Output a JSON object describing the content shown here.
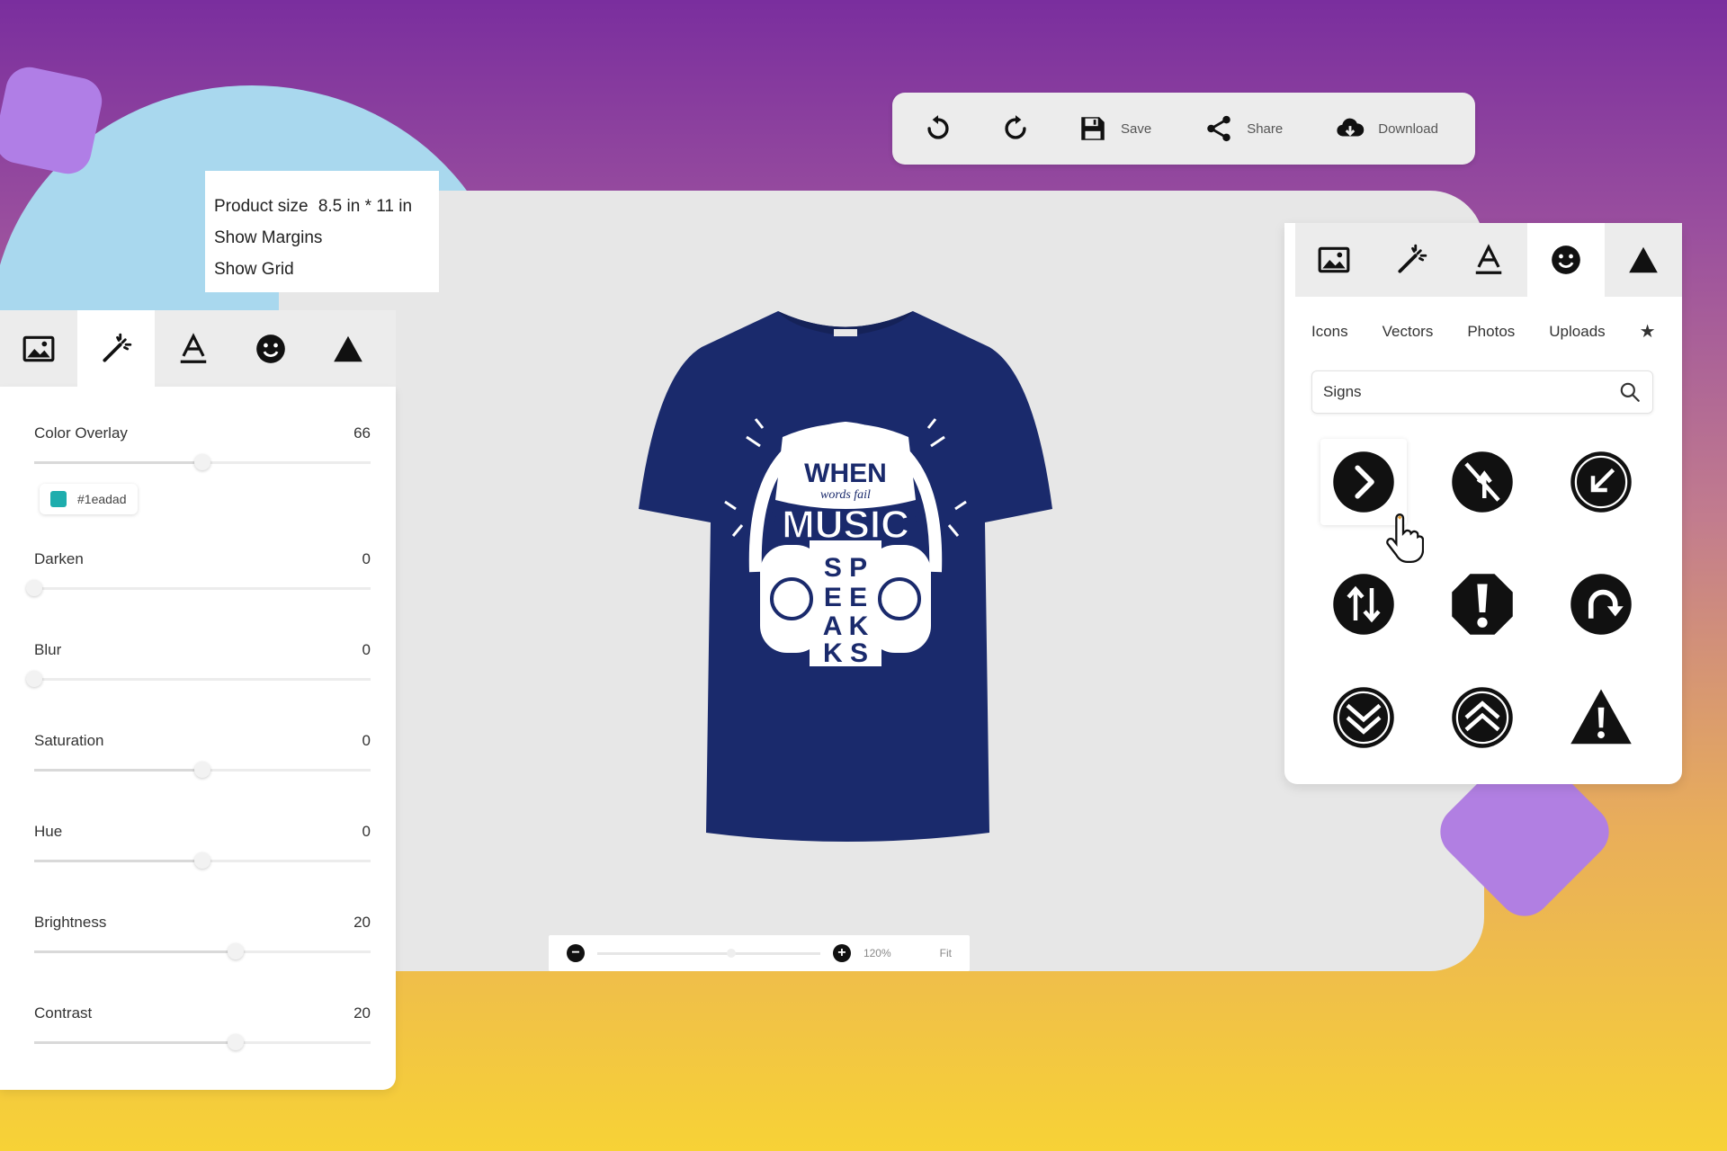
{
  "product_info": {
    "size_label": "Product size",
    "size_value": "8.5 in * 11 in",
    "show_margins": "Show Margins",
    "show_grid": "Show Grid"
  },
  "toolbar": {
    "save_label": "Save",
    "share_label": "Share",
    "download_label": "Download"
  },
  "left_panel": {
    "tabs": [
      "image-icon",
      "magic-wand-icon",
      "text-icon",
      "smiley-icon",
      "shape-triangle-icon"
    ],
    "active_tab": 1,
    "color_hex": "#1eadad",
    "color_label": "#1eadad",
    "sliders": [
      {
        "label": "Color Overlay",
        "value": "66",
        "fraction": 0.5
      },
      {
        "label": "Darken",
        "value": "0",
        "fraction": 0.0
      },
      {
        "label": "Blur",
        "value": "0",
        "fraction": 0.0
      },
      {
        "label": "Saturation",
        "value": "0",
        "fraction": 0.5
      },
      {
        "label": "Hue",
        "value": "0",
        "fraction": 0.5
      },
      {
        "label": "Brightness",
        "value": "20",
        "fraction": 0.6
      },
      {
        "label": "Contrast",
        "value": "20",
        "fraction": 0.6
      }
    ]
  },
  "right_panel": {
    "active_tab": 3,
    "subtabs": [
      "Icons",
      "Vectors",
      "Photos",
      "Uploads"
    ],
    "search_value": "Signs",
    "icons": [
      "chevron-right-sign-icon",
      "no-left-turn-sign-icon",
      "arrow-down-left-sign-icon",
      "swap-vertical-sign-icon",
      "exclamation-octagon-sign-icon",
      "redo-arrow-sign-icon",
      "double-chevron-down-sign-icon",
      "double-chevron-up-sign-icon",
      "warning-triangle-sign-icon"
    ]
  },
  "shirt": {
    "color": "#1a2a6c",
    "print_text": [
      "WHEN",
      "words fail",
      "MUSIC",
      "S P",
      "E E",
      "A K",
      "K S",
      "SPEAKS"
    ]
  },
  "zoom": {
    "value": "120%",
    "fraction": 0.6,
    "fit_label": "Fit"
  },
  "colors": {
    "accent_purple": "#b07ee6",
    "blob_blue": "#a9d8ee",
    "canvas_bg": "#e7e7e7"
  }
}
